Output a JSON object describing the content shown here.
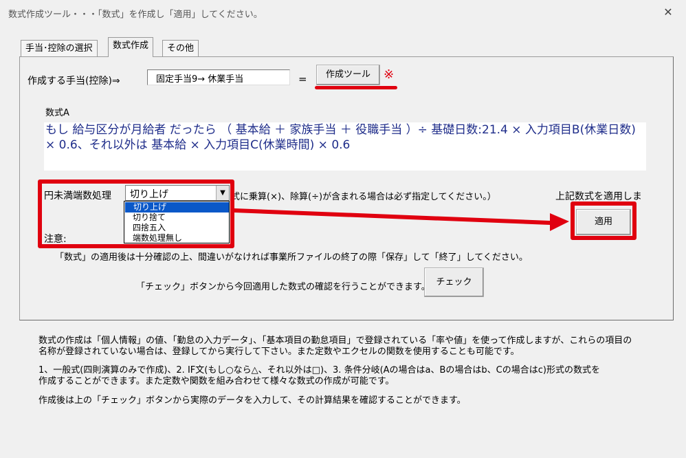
{
  "window": {
    "title": "数式作成ツール・・・「数式」を作成し「適用」してください。",
    "close_icon": "close-icon"
  },
  "tabs": [
    {
      "label": "手当･控除の選択",
      "active": false
    },
    {
      "label": "数式作成",
      "active": true
    },
    {
      "label": "その他",
      "active": false
    }
  ],
  "form": {
    "target_label": "作成する手当(控除)⇒",
    "target_value": "固定手当9→ 休業手当",
    "equals": "=",
    "create_tool_button": "作成ツール",
    "asterisk_mark": "※",
    "formula_label": "数式A",
    "formula_text": "もし 給与区分が月給者 だったら （ 基本給 ＋ 家族手当 ＋ 役職手当 ）÷ 基礎日数:21.4 × 入力項目B(休業日数) × 0.6、それ以外は 基本給 × 入力項目C(休業時間) × 0.6",
    "rounding_label": "円未満端数処理",
    "rounding_selected": "切り上げ",
    "rounding_options": [
      "切り上げ",
      "切り捨て",
      "四捨五入",
      "端数処理無し"
    ],
    "rounding_note": "式に乗算(×)、除算(÷)が含まれる場合は必ず指定してください。）",
    "apply_caption": "上記数式を適用しま",
    "apply_button": "適用",
    "note_label": "注意:",
    "note_text": "「数式」の適用後は十分確認の上、間違いがなければ事業所ファイルの終了の際「保存」して「終了」してください。",
    "check_text": "「チェック」ボタンから今回適用した数式の確認を行うことができます。⇒",
    "check_button": "チェック"
  },
  "info": {
    "para1_line1": "数式の作成は「個人情報」の値、「勤怠の入力データ」、「基本項目の勤怠項目」で登録されている「率や値」を使って作成しますが、これらの項目の",
    "para1_line2": "名称が登録されていない場合は、登録してから実行して下さい。また定数やエクセルの関数を使用することも可能です。",
    "para2_line1": "1、一般式(四則演算のみで作成)、2. IF文(もし○なら△、それ以外は□)、3. 条件分岐(Aの場合はa、Bの場合はb、Cの場合はc)形式の数式を",
    "para2_line2": "作成することができます。また定数や関数を組み合わせて様々な数式の作成が可能です。",
    "para3": "作成後は上の「チェック」ボタンから実際のデータを入力して、その計算結果を確認することができます。"
  },
  "colors": {
    "highlight_red": "#e0000f",
    "formula_blue": "#1f2d8a",
    "selection_blue": "#0a58c8"
  }
}
